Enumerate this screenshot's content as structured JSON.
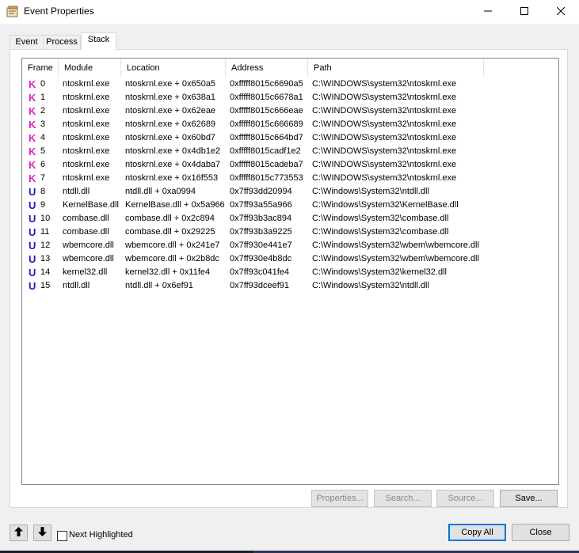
{
  "window": {
    "title": "Event Properties",
    "icon": "event-properties-icon",
    "controls": {
      "minimize": "minimize-icon",
      "maximize": "maximize-icon",
      "close": "close-icon"
    }
  },
  "tabs": [
    {
      "label": "Event",
      "active": false
    },
    {
      "label": "Process",
      "active": false
    },
    {
      "label": "Stack",
      "active": true
    }
  ],
  "table": {
    "columns": [
      "Frame",
      "Module",
      "Location",
      "Address",
      "Path"
    ],
    "rows": [
      {
        "badge": "K",
        "frame": "0",
        "module": "ntoskrnl.exe",
        "location": "ntoskrnl.exe + 0x650a5",
        "address": "0xfffff8015c6690a5",
        "path": "C:\\WINDOWS\\system32\\ntoskrnl.exe"
      },
      {
        "badge": "K",
        "frame": "1",
        "module": "ntoskrnl.exe",
        "location": "ntoskrnl.exe + 0x638a1",
        "address": "0xfffff8015c6678a1",
        "path": "C:\\WINDOWS\\system32\\ntoskrnl.exe"
      },
      {
        "badge": "K",
        "frame": "2",
        "module": "ntoskrnl.exe",
        "location": "ntoskrnl.exe + 0x62eae",
        "address": "0xfffff8015c666eae",
        "path": "C:\\WINDOWS\\system32\\ntoskrnl.exe"
      },
      {
        "badge": "K",
        "frame": "3",
        "module": "ntoskrnl.exe",
        "location": "ntoskrnl.exe + 0x62689",
        "address": "0xfffff8015c666689",
        "path": "C:\\WINDOWS\\system32\\ntoskrnl.exe"
      },
      {
        "badge": "K",
        "frame": "4",
        "module": "ntoskrnl.exe",
        "location": "ntoskrnl.exe + 0x60bd7",
        "address": "0xfffff8015c664bd7",
        "path": "C:\\WINDOWS\\system32\\ntoskrnl.exe"
      },
      {
        "badge": "K",
        "frame": "5",
        "module": "ntoskrnl.exe",
        "location": "ntoskrnl.exe + 0x4db1e2",
        "address": "0xfffff8015cadf1e2",
        "path": "C:\\WINDOWS\\system32\\ntoskrnl.exe"
      },
      {
        "badge": "K",
        "frame": "6",
        "module": "ntoskrnl.exe",
        "location": "ntoskrnl.exe + 0x4daba7",
        "address": "0xfffff8015cadeba7",
        "path": "C:\\WINDOWS\\system32\\ntoskrnl.exe"
      },
      {
        "badge": "K",
        "frame": "7",
        "module": "ntoskrnl.exe",
        "location": "ntoskrnl.exe + 0x16f553",
        "address": "0xfffff8015c773553",
        "path": "C:\\WINDOWS\\system32\\ntoskrnl.exe"
      },
      {
        "badge": "U",
        "frame": "8",
        "module": "ntdll.dll",
        "location": "ntdll.dll + 0xa0994",
        "address": "0x7ff93dd20994",
        "path": "C:\\Windows\\System32\\ntdll.dll"
      },
      {
        "badge": "U",
        "frame": "9",
        "module": "KernelBase.dll",
        "location": "KernelBase.dll + 0x5a966",
        "address": "0x7ff93a55a966",
        "path": "C:\\Windows\\System32\\KernelBase.dll"
      },
      {
        "badge": "U",
        "frame": "10",
        "module": "combase.dll",
        "location": "combase.dll + 0x2c894",
        "address": "0x7ff93b3ac894",
        "path": "C:\\Windows\\System32\\combase.dll"
      },
      {
        "badge": "U",
        "frame": "11",
        "module": "combase.dll",
        "location": "combase.dll + 0x29225",
        "address": "0x7ff93b3a9225",
        "path": "C:\\Windows\\System32\\combase.dll"
      },
      {
        "badge": "U",
        "frame": "12",
        "module": "wbemcore.dll",
        "location": "wbemcore.dll + 0x241e7",
        "address": "0x7ff930e441e7",
        "path": "C:\\Windows\\System32\\wbem\\wbemcore.dll"
      },
      {
        "badge": "U",
        "frame": "13",
        "module": "wbemcore.dll",
        "location": "wbemcore.dll + 0x2b8dc",
        "address": "0x7ff930e4b8dc",
        "path": "C:\\Windows\\System32\\wbem\\wbemcore.dll"
      },
      {
        "badge": "U",
        "frame": "14",
        "module": "kernel32.dll",
        "location": "kernel32.dll + 0x11fe4",
        "address": "0x7ff93c041fe4",
        "path": "C:\\Windows\\System32\\kernel32.dll"
      },
      {
        "badge": "U",
        "frame": "15",
        "module": "ntdll.dll",
        "location": "ntdll.dll + 0x6ef91",
        "address": "0x7ff93dceef91",
        "path": "C:\\Windows\\System32\\ntdll.dll"
      }
    ]
  },
  "colors": {
    "kernel_badge": "#e020c8",
    "user_badge": "#1a1acc",
    "accent": "#0078d7"
  },
  "panel_buttons": {
    "properties": "Properties...",
    "search": "Search...",
    "source": "Source...",
    "save": "Save..."
  },
  "footer": {
    "up_icon": "arrow-up-icon",
    "down_icon": "arrow-down-icon",
    "next_highlighted_label": "Next Highlighted",
    "next_highlighted_checked": false,
    "copy_all": "Copy All",
    "close": "Close"
  }
}
